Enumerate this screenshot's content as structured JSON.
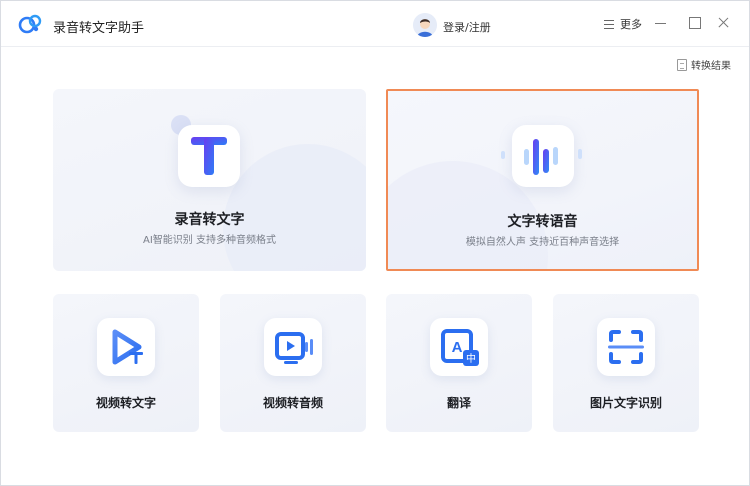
{
  "app": {
    "title": "录音转文字助手"
  },
  "header": {
    "login_label": "登录/注册",
    "more_label": "更多"
  },
  "toolbar": {
    "convert_result_label": "转换结果"
  },
  "features": {
    "big": [
      {
        "title": "录音转文字",
        "subtitle": "AI智能识别 支持多种音频格式",
        "icon": "text-t-icon",
        "selected": false
      },
      {
        "title": "文字转语音",
        "subtitle": "模拟自然人声 支持近百种声音选择",
        "icon": "sound-wave-icon",
        "selected": true
      }
    ],
    "small": [
      {
        "title": "视频转文字",
        "icon": "video-to-text-icon"
      },
      {
        "title": "视频转音频",
        "icon": "video-to-audio-icon"
      },
      {
        "title": "翻译",
        "icon": "translate-icon"
      },
      {
        "title": "图片文字识别",
        "icon": "image-ocr-icon"
      }
    ]
  },
  "colors": {
    "accent_blue": "#2f7cf6",
    "accent_purple": "#6a3df0",
    "selected_border": "#f08a55",
    "card_bg": "#f2f4fa"
  }
}
